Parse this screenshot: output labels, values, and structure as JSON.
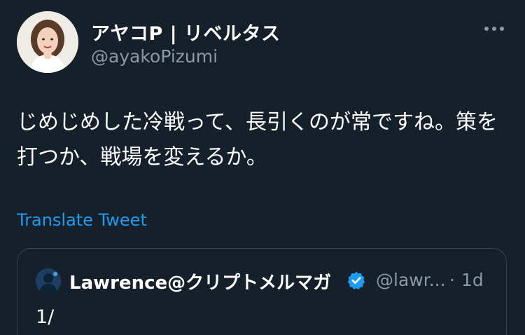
{
  "tweet": {
    "author": {
      "display_name": "アヤコP | リベルタス",
      "handle": "@ayakoPizumi",
      "avatar_icon": "profile-photo-icon"
    },
    "more_icon": "more-horizontal-icon",
    "text": "じめじめした冷戦って、長引くのが常ですね。策を打つか、戦場を変えるか。",
    "translate_label": "Translate Tweet"
  },
  "quoted_tweet": {
    "author": {
      "display_name": "Lawrence@クリプトメルマガ",
      "handle": "@lawr...",
      "verified_icon": "verified-badge-icon"
    },
    "separator": "·",
    "time": "1d",
    "text": "1/"
  },
  "colors": {
    "background": "#15202b",
    "text": "#ffffff",
    "secondary_text": "#8b98a5",
    "link": "#1d9bf0",
    "border": "#38444d",
    "verified": "#1d9bf0"
  }
}
